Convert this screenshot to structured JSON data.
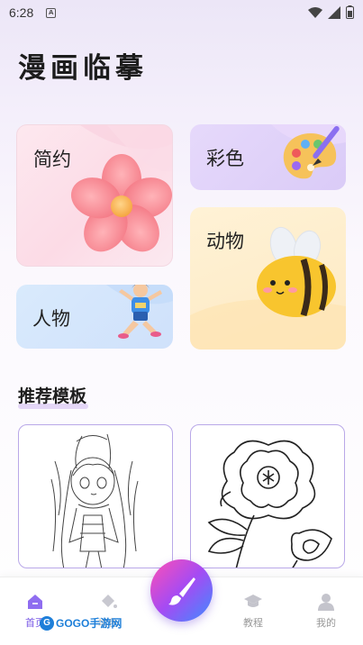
{
  "status_bar": {
    "time": "6:28",
    "notification_icon": "A"
  },
  "app": {
    "title": "漫画临摹"
  },
  "categories": {
    "simple": {
      "label": "简约"
    },
    "color": {
      "label": "彩色"
    },
    "people": {
      "label": "人物"
    },
    "animal": {
      "label": "动物"
    }
  },
  "section": {
    "title": "推荐模板"
  },
  "bottom_nav": {
    "home": "首页",
    "coloring": "填色",
    "tutorial": "教程",
    "mine": "我的"
  },
  "watermark": {
    "text": "GOGO手游网"
  },
  "colors": {
    "accent": "#7a5ae6",
    "fab_gradient_start": "#ff4fb4",
    "fab_gradient_end": "#3d8cff",
    "template_border": "#b9a8e8"
  }
}
